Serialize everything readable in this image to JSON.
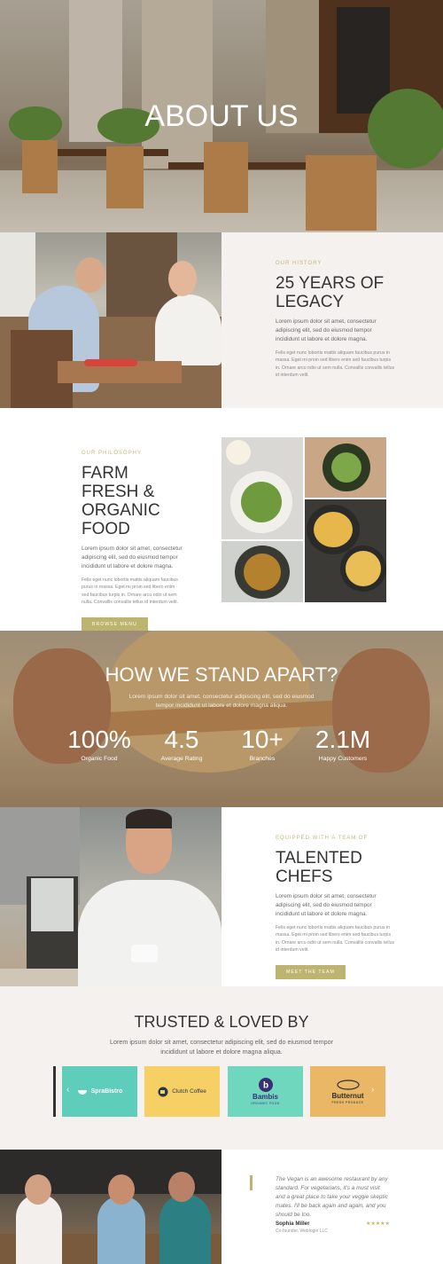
{
  "hero": {
    "title": "ABOUT US"
  },
  "story": {
    "kicker": "OUR HISTORY",
    "heading_line1": "25 YEARS OF",
    "heading_line2": "LEGACY",
    "para1": "Lorem ipsum dolor sit amet, consectetur adipiscing elit, sed do eiusmod tempor incididunt ut labore et dolore magna.",
    "para2": "Felis eget nunc lobortis mattis aliquam faucibus purus in massa. Eget mi proin sed libero enim sed faucibus turpis in. Ornare arcu odio ut sem nulla. Convallis convallis tellus id interdum velit."
  },
  "philosophy": {
    "kicker": "OUR PHILOSOPHY",
    "heading_line1": "FARM FRESH &",
    "heading_line2": "ORGANIC FOOD",
    "para1": "Lorem ipsum dolor sit amet, consectetur adipiscing elit, sed do eiusmod tempor incididunt ut labore et dolore magna.",
    "para2": "Felis eget nunc lobortis mattis aliquam faucibus purus in massa. Eget mi proin sed libero enim sed faucibus turpis in. Ornare arcu odio ut sem nulla. Convallis convallis tellus id interdum velit.",
    "button": "BROWSE MENU"
  },
  "apart": {
    "title": "HOW WE STAND APART?",
    "subtitle": "Lorem ipsum dolor sit amet, consectetur adipiscing elit, sed do eiusmod tempor incididunt ut labore et dolore magna aliqua.",
    "stats": [
      {
        "value": "100%",
        "label": "Organic Food"
      },
      {
        "value": "4.5",
        "label": "Average Rating"
      },
      {
        "value": "10+",
        "label": "Branches"
      },
      {
        "value": "2.1M",
        "label": "Happy Customers"
      }
    ]
  },
  "chefs": {
    "kicker": "EQUIPPED WITH A TEAM OF",
    "heading": "TALENTED CHEFS",
    "para1": "Lorem ipsum dolor sit amet, consectetur adipiscing elit, sed do eiusmod tempor incididunt ut labore et dolore magna.",
    "para2": "Felis eget nunc lobortis mattis aliquam faucibus purus in massa. Eget mi proin sed libero enim sed faucibus turpis in. Ornare arcu odio ut sem nulla. Convallis convallis tellus id interdum velit.",
    "button": "MEET THE TEAM"
  },
  "trusted": {
    "title": "TRUSTED & LOVED BY",
    "subtitle": "Lorem ipsum dolor sit amet, consectetur adipiscing elit, sed do eiusmod tempor incididunt ut labore et dolore magna aliqua.",
    "prev": "‹",
    "next": "›",
    "logos": [
      {
        "name": "SpraBistro",
        "sub": "",
        "bg": "#5ecdb9",
        "color": "#ffffff"
      },
      {
        "name": "Clutch Coffee",
        "sub": "",
        "bg": "#f6cf65",
        "color": "#243a4c"
      },
      {
        "name": "Bambis",
        "sub": "ORGANIC FOOD",
        "bg": "#6fd7be",
        "color": "#3a2f73"
      },
      {
        "name": "Butternut",
        "sub": "FRESH PRODUCE",
        "bg": "#e9b765",
        "color": "#2c2c2c"
      }
    ]
  },
  "testimonial": {
    "quote": "The Vegan is an awesome restaurant by any standard. For vegetarians, it's a must visit and a great place to take your veggie skeptic mates. I'll be back again and again, and you should be too.",
    "name": "Sophia Miller",
    "role": "Co-founder, Weblogin LLC",
    "stars": "★★★★★",
    "rating": 5
  },
  "colors": {
    "accent": "#bcb46f",
    "panel": "#f4f1ee"
  }
}
